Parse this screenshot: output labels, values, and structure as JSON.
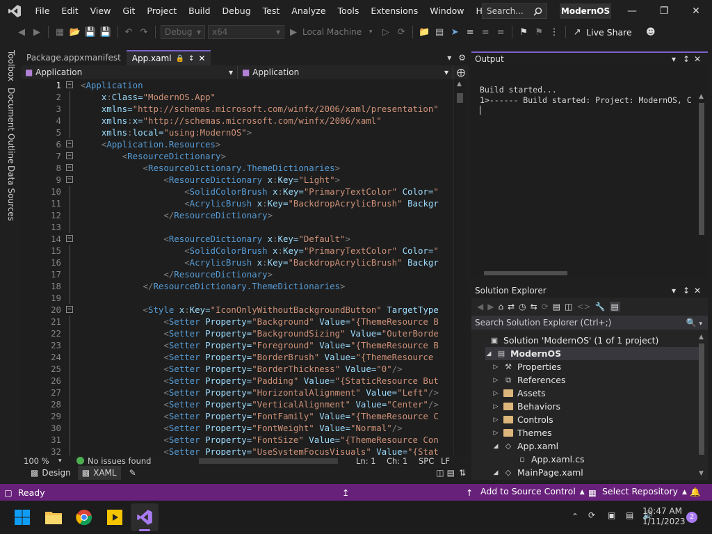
{
  "menu": [
    "File",
    "Edit",
    "View",
    "Git",
    "Project",
    "Build",
    "Debug",
    "Test",
    "Analyze",
    "Tools",
    "Extensions",
    "Window",
    "Help"
  ],
  "search": {
    "label": "Search..."
  },
  "project_name": "ModernOS",
  "toolbar": {
    "config": "Debug",
    "platform": "x64",
    "run_label": "Local Machine",
    "live_share": "Live Share"
  },
  "left_rail": [
    "Toolbox",
    "Document Outline",
    "Data Sources"
  ],
  "editor": {
    "tabs": [
      {
        "label": "Package.appxmanifest",
        "active": false
      },
      {
        "label": "App.xaml",
        "active": true
      }
    ],
    "nav_left": "Application",
    "nav_right": "Application",
    "zoom": "100 %",
    "issues": "No issues found",
    "line": "Ln: 1",
    "col": "Ch: 1",
    "ins": "SPC",
    "eol": "LF",
    "design_tab": "Design",
    "xaml_tab": "XAML"
  },
  "code_lines": [
    "<Application",
    "    x:Class=\"ModernOS.App\"",
    "    xmlns=\"http://schemas.microsoft.com/winfx/2006/xaml/presentation\"",
    "    xmlns:x=\"http://schemas.microsoft.com/winfx/2006/xaml\"",
    "    xmlns:local=\"using:ModernOS\">",
    "    <Application.Resources>",
    "        <ResourceDictionary>",
    "            <ResourceDictionary.ThemeDictionaries>",
    "                <ResourceDictionary x:Key=\"Light\">",
    "                    <SolidColorBrush x:Key=\"PrimaryTextColor\" Color=\"",
    "                    <AcrylicBrush x:Key=\"BackdropAcrylicBrush\" Backgr",
    "                </ResourceDictionary>",
    "",
    "                <ResourceDictionary x:Key=\"Default\">",
    "                    <SolidColorBrush x:Key=\"PrimaryTextColor\" Color=\"",
    "                    <AcrylicBrush x:Key=\"BackdropAcrylicBrush\" Backgr",
    "                </ResourceDictionary>",
    "            </ResourceDictionary.ThemeDictionaries>",
    "",
    "            <Style x:Key=\"IconOnlyWithoutBackgroundButton\" TargetType",
    "                <Setter Property=\"Background\" Value=\"{ThemeResource B",
    "                <Setter Property=\"BackgroundSizing\" Value=\"OuterBorde",
    "                <Setter Property=\"Foreground\" Value=\"{ThemeResource B",
    "                <Setter Property=\"BorderBrush\" Value=\"{ThemeResource ",
    "                <Setter Property=\"BorderThickness\" Value=\"0\"/>",
    "                <Setter Property=\"Padding\" Value=\"{StaticResource But",
    "                <Setter Property=\"HorizontalAlignment\" Value=\"Left\"/>",
    "                <Setter Property=\"VerticalAlignment\" Value=\"Center\"/>",
    "                <Setter Property=\"FontFamily\" Value=\"{ThemeResource C",
    "                <Setter Property=\"FontWeight\" Value=\"Normal\"/>",
    "                <Setter Property=\"FontSize\" Value=\"{ThemeResource Con",
    "                <Setter Property=\"UseSystemFocusVisuals\" Value=\"{Stat"
  ],
  "output": {
    "title": "Output",
    "lines": [
      "Build started...",
      "1>------ Build started: Project: ModernOS, C"
    ]
  },
  "solution_explorer": {
    "title": "Solution Explorer",
    "search": "Search Solution Explorer (Ctrl+;)",
    "items": [
      {
        "label": "Solution 'ModernOS' (1 of 1 project)",
        "level": 0,
        "icon": "solution-icon",
        "expander": ""
      },
      {
        "label": "ModernOS",
        "level": 1,
        "icon": "csharp-project-icon",
        "expander": "open",
        "bold": true
      },
      {
        "label": "Properties",
        "level": 2,
        "icon": "wrench-icon",
        "expander": "closed"
      },
      {
        "label": "References",
        "level": 2,
        "icon": "references-icon",
        "expander": "closed"
      },
      {
        "label": "Assets",
        "level": 2,
        "icon": "folder-icon",
        "expander": "closed"
      },
      {
        "label": "Behaviors",
        "level": 2,
        "icon": "folder-icon",
        "expander": "closed"
      },
      {
        "label": "Controls",
        "level": 2,
        "icon": "folder-icon",
        "expander": "closed"
      },
      {
        "label": "Themes",
        "level": 2,
        "icon": "folder-icon",
        "expander": "closed"
      },
      {
        "label": "App.xaml",
        "level": 2,
        "icon": "xaml-file-icon",
        "expander": "open"
      },
      {
        "label": "App.xaml.cs",
        "level": 3,
        "icon": "csharp-file-icon",
        "expander": ""
      },
      {
        "label": "MainPage.xaml",
        "level": 2,
        "icon": "xaml-file-icon",
        "expander": "open"
      }
    ]
  },
  "status": {
    "ready": "Ready",
    "source_control": "Add to Source Control",
    "repo": "Select Repository",
    "bell_count": ""
  },
  "clock": {
    "time": "10:47 AM",
    "date": "1/11/2023",
    "notifications": "2"
  },
  "colors": {
    "accent": "#68217a",
    "tab_accent": "#7c62c9",
    "tag": "#569cd6",
    "attr": "#9cdcfe",
    "value": "#ce9178",
    "punct": "#808080"
  }
}
